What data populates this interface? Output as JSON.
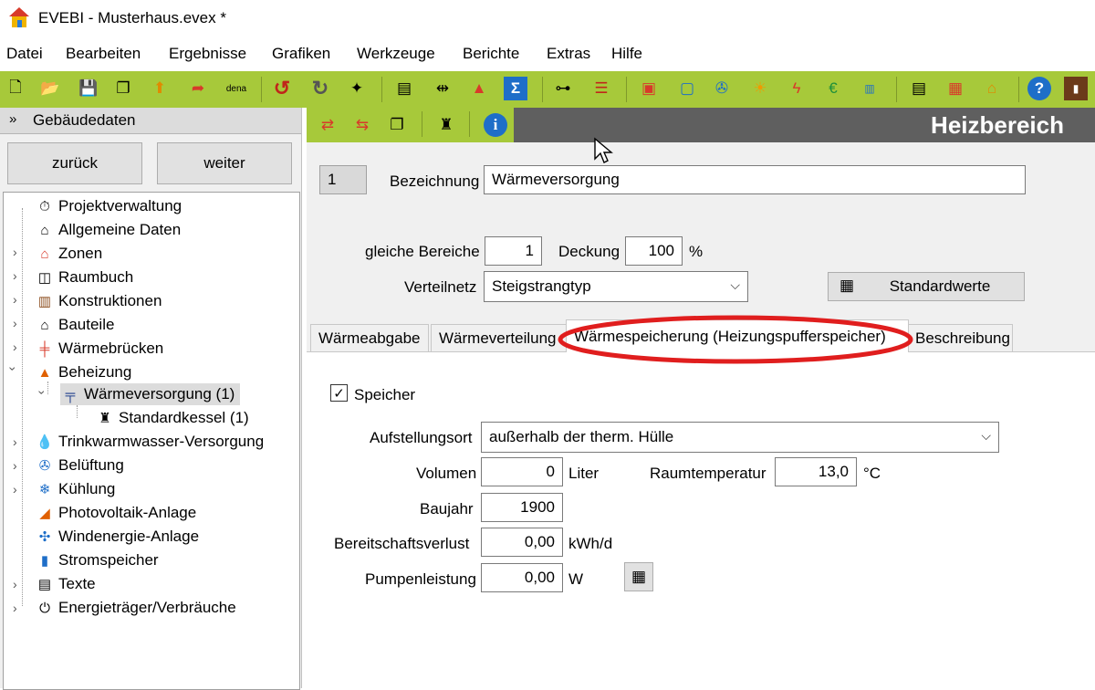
{
  "window": {
    "title": "EVEBI - Musterhaus.evex *"
  },
  "menu": [
    "Datei",
    "Bearbeiten",
    "Ergebnisse",
    "Grafiken",
    "Werkzeuge",
    "Berichte",
    "Extras",
    "Hilfe"
  ],
  "toolbar": {
    "dena_label": "dena"
  },
  "left": {
    "header": "Gebäudedaten",
    "back_label": "zurück",
    "next_label": "weiter",
    "tree": [
      "Projektverwaltung",
      "Allgemeine Daten",
      "Zonen",
      "Raumbuch",
      "Konstruktionen",
      "Bauteile",
      "Wärmebrücken",
      "Beheizung",
      "Wärmeversorgung (1)",
      "Standardkessel (1)",
      "Trinkwarmwasser-Versorgung",
      "Belüftung",
      "Kühlung",
      "Photovoltaik-Anlage",
      "Windenergie-Anlage",
      "Stromspeicher",
      "Texte",
      "Energieträger/Verbräuche"
    ]
  },
  "main": {
    "banner": "Heizbereich",
    "index": "1",
    "bezeichnung_label": "Bezeichnung",
    "bezeichnung_value": "Wärmeversorgung",
    "gleiche_label": "gleiche Bereiche",
    "gleiche_value": "1",
    "deckung_label": "Deckung",
    "deckung_value": "100",
    "deckung_unit": "%",
    "verteilnetz_label": "Verteilnetz",
    "verteilnetz_value": "Steigstrangtyp",
    "standardwerte_label": "Standardwerte",
    "tabs": [
      "Wärmeabgabe",
      "Wärmeverteilung",
      "Wärmespeicherung (Heizungspufferspeicher)",
      "Beschreibung"
    ],
    "speicher_label": "Speicher",
    "speicher_checked": true,
    "aufstellungsort_label": "Aufstellungsort",
    "aufstellungsort_value": "außerhalb der therm. Hülle",
    "volumen_label": "Volumen",
    "volumen_value": "0",
    "volumen_unit": "Liter",
    "raumtemp_label": "Raumtemperatur",
    "raumtemp_value": "13,0",
    "raumtemp_unit": "°C",
    "baujahr_label": "Baujahr",
    "baujahr_value": "1900",
    "bereitschaft_label": "Bereitschaftsverlust",
    "bereitschaft_value": "0,00",
    "bereitschaft_unit": "kWh/d",
    "pumpen_label": "Pumpenleistung",
    "pumpen_value": "0,00",
    "pumpen_unit": "W"
  }
}
